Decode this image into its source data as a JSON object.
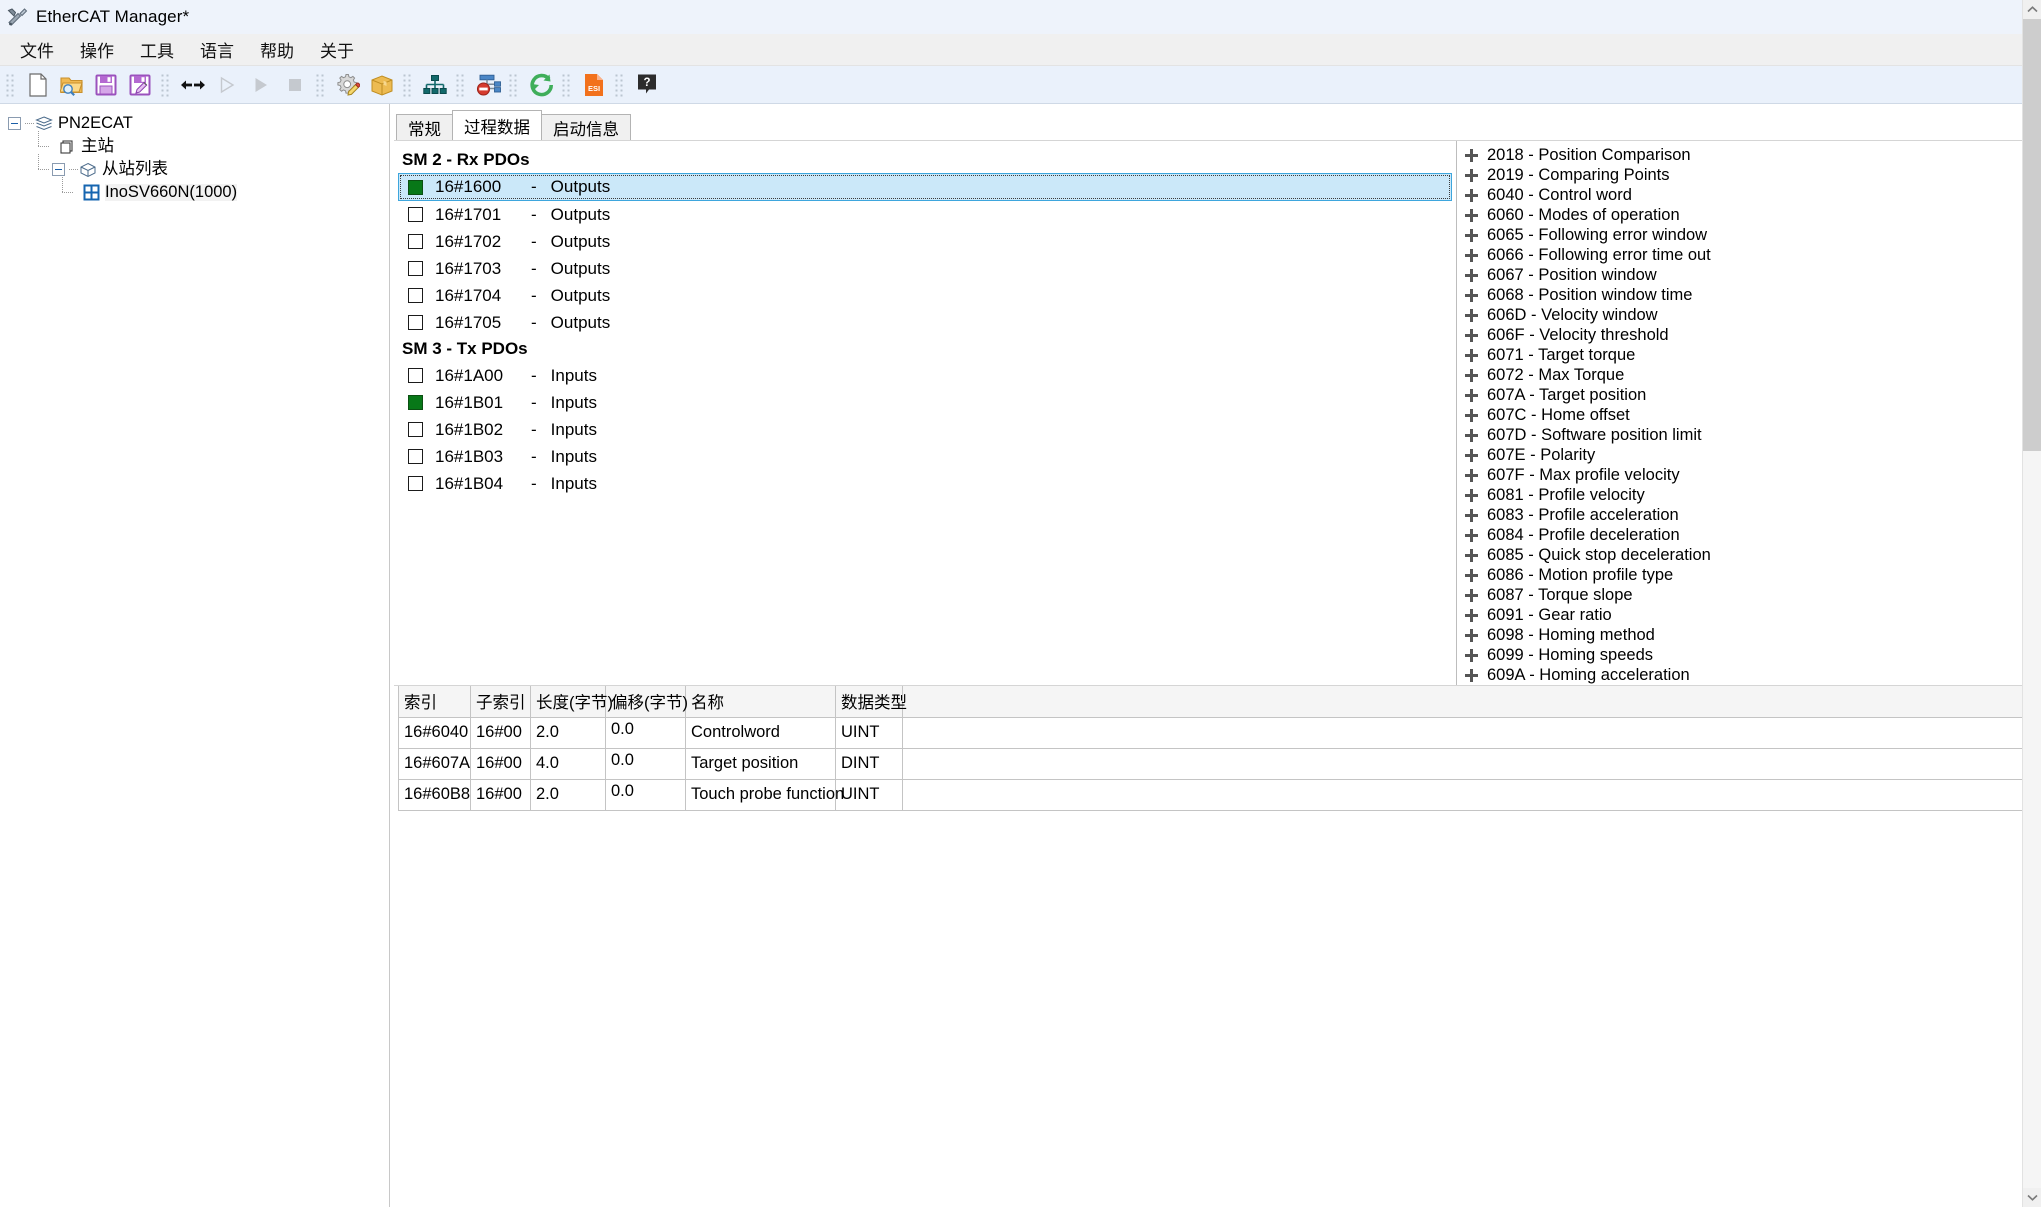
{
  "window": {
    "title": "EtherCAT Manager*",
    "app_icon": "wrench-screwdriver-icon"
  },
  "menu": {
    "items": [
      {
        "label": "文件",
        "name": "menu-file"
      },
      {
        "label": "操作",
        "name": "menu-operation"
      },
      {
        "label": "工具",
        "name": "menu-tools"
      },
      {
        "label": "语言",
        "name": "menu-language"
      },
      {
        "label": "帮助",
        "name": "menu-help"
      },
      {
        "label": "关于",
        "name": "menu-about"
      }
    ]
  },
  "toolbar": {
    "groups": [
      {
        "buttons": [
          {
            "icon": "new-file-icon",
            "name": "new-button",
            "enabled": true
          },
          {
            "icon": "open-folder-icon",
            "name": "open-button",
            "enabled": true
          },
          {
            "icon": "save-icon",
            "name": "save-button",
            "enabled": true
          },
          {
            "icon": "save-as-icon",
            "name": "save-as-button",
            "enabled": true
          }
        ]
      },
      {
        "buttons": [
          {
            "icon": "connect-icon",
            "name": "connect-button",
            "enabled": true
          },
          {
            "icon": "play-outline-icon",
            "name": "run-button",
            "enabled": false
          },
          {
            "icon": "play-icon",
            "name": "start-button",
            "enabled": false
          },
          {
            "icon": "stop-icon",
            "name": "stop-button",
            "enabled": false
          }
        ]
      },
      {
        "buttons": [
          {
            "icon": "gear-pencil-icon",
            "name": "configure-button",
            "enabled": true
          },
          {
            "icon": "box-icon",
            "name": "package-button",
            "enabled": true
          }
        ]
      },
      {
        "buttons": [
          {
            "icon": "network-topology-icon",
            "name": "scan-network-button",
            "enabled": true
          }
        ]
      },
      {
        "buttons": [
          {
            "icon": "disable-node-icon",
            "name": "disable-node-button",
            "enabled": true
          }
        ]
      },
      {
        "buttons": [
          {
            "icon": "refresh-icon",
            "name": "refresh-button",
            "enabled": true
          }
        ]
      },
      {
        "buttons": [
          {
            "icon": "esi-file-icon",
            "name": "esi-import-button",
            "enabled": true
          }
        ]
      },
      {
        "buttons": [
          {
            "icon": "help-icon",
            "name": "help-button",
            "enabled": true
          }
        ]
      }
    ]
  },
  "tree": {
    "root": {
      "label": "PN2ECAT",
      "icon": "stack-icon"
    },
    "children": [
      {
        "label": "主站",
        "icon": "master-node-icon",
        "indent": 2
      },
      {
        "label": "从站列表",
        "icon": "slave-list-icon",
        "indent": 2
      },
      {
        "label": "InoSV660N(1000)",
        "icon": "servo-device-icon",
        "indent": 3,
        "selected": true
      }
    ]
  },
  "tabs": [
    {
      "label": "常规",
      "name": "tab-general",
      "active": false
    },
    {
      "label": "过程数据",
      "name": "tab-process-data",
      "active": true
    },
    {
      "label": "启动信息",
      "name": "tab-startup-info",
      "active": false
    }
  ],
  "pdo": {
    "sections": [
      {
        "title": "SM 2 - Rx PDOs",
        "rows": [
          {
            "id": "16#1600",
            "dash": "-",
            "dir": "Outputs",
            "checked": true,
            "selected": true
          },
          {
            "id": "16#1701",
            "dash": "-",
            "dir": "Outputs",
            "checked": false,
            "selected": false
          },
          {
            "id": "16#1702",
            "dash": "-",
            "dir": "Outputs",
            "checked": false,
            "selected": false
          },
          {
            "id": "16#1703",
            "dash": "-",
            "dir": "Outputs",
            "checked": false,
            "selected": false
          },
          {
            "id": "16#1704",
            "dash": "-",
            "dir": "Outputs",
            "checked": false,
            "selected": false
          },
          {
            "id": "16#1705",
            "dash": "-",
            "dir": "Outputs",
            "checked": false,
            "selected": false
          }
        ]
      },
      {
        "title": "SM 3 - Tx PDOs",
        "rows": [
          {
            "id": "16#1A00",
            "dash": "-",
            "dir": "Inputs",
            "checked": false,
            "selected": false
          },
          {
            "id": "16#1B01",
            "dash": "-",
            "dir": "Inputs",
            "checked": true,
            "selected": false
          },
          {
            "id": "16#1B02",
            "dash": "-",
            "dir": "Inputs",
            "checked": false,
            "selected": false
          },
          {
            "id": "16#1B03",
            "dash": "-",
            "dir": "Inputs",
            "checked": false,
            "selected": false
          },
          {
            "id": "16#1B04",
            "dash": "-",
            "dir": "Inputs",
            "checked": false,
            "selected": false
          }
        ]
      }
    ]
  },
  "object_dictionary": {
    "entries": [
      "2018 - Position Comparison",
      "2019 - Comparing Points",
      "6040 - Control word",
      "6060 - Modes of operation",
      "6065 - Following error window",
      "6066 - Following error time out",
      "6067 - Position window",
      "6068 - Position window time",
      "606D - Velocity window",
      "606F - Velocity threshold",
      "6071 - Target torque",
      "6072 - Max Torque",
      "607A - Target position",
      "607C - Home offset",
      "607D - Software position limit",
      "607E - Polarity",
      "607F - Max profile velocity",
      "6081 - Profile velocity",
      "6083 - Profile acceleration",
      "6084 - Profile deceleration",
      "6085 - Quick stop deceleration",
      "6086 - Motion profile type",
      "6087 - Torque slope",
      "6091 - Gear ratio",
      "6098 - Homing method",
      "6099 - Homing speeds",
      "609A - Homing acceleration"
    ]
  },
  "table": {
    "columns": [
      {
        "label": "索引",
        "name": "col-index"
      },
      {
        "label": "子索引",
        "name": "col-subindex"
      },
      {
        "label": "长度(字节)",
        "name": "col-length"
      },
      {
        "label": "偏移(字节)",
        "name": "col-offset"
      },
      {
        "label": "名称",
        "name": "col-name"
      },
      {
        "label": "数据类型",
        "name": "col-datatype"
      },
      {
        "label": "",
        "name": "col-spacer"
      }
    ],
    "rows": [
      {
        "index": "16#6040",
        "subindex": "16#00",
        "length": "2.0",
        "offset": "0.0",
        "name": "Controlword",
        "datatype": "UINT"
      },
      {
        "index": "16#607A",
        "subindex": "16#00",
        "length": "4.0",
        "offset": "0.0",
        "name": "Target position",
        "datatype": "DINT"
      },
      {
        "index": "16#60B8",
        "subindex": "16#00",
        "length": "2.0",
        "offset": "0.0",
        "name": "Touch probe function",
        "datatype": "UINT"
      }
    ]
  },
  "scrollbar": {
    "up_glyph": "︿",
    "down_glyph": "﹀"
  },
  "colors": {
    "selection_bg": "#cbe8f9",
    "selection_border": "#3ea6dd",
    "checked_green": "#087818",
    "toolbar_bg": "#eaf1fb",
    "titlebar_bg": "#eef3fb"
  }
}
